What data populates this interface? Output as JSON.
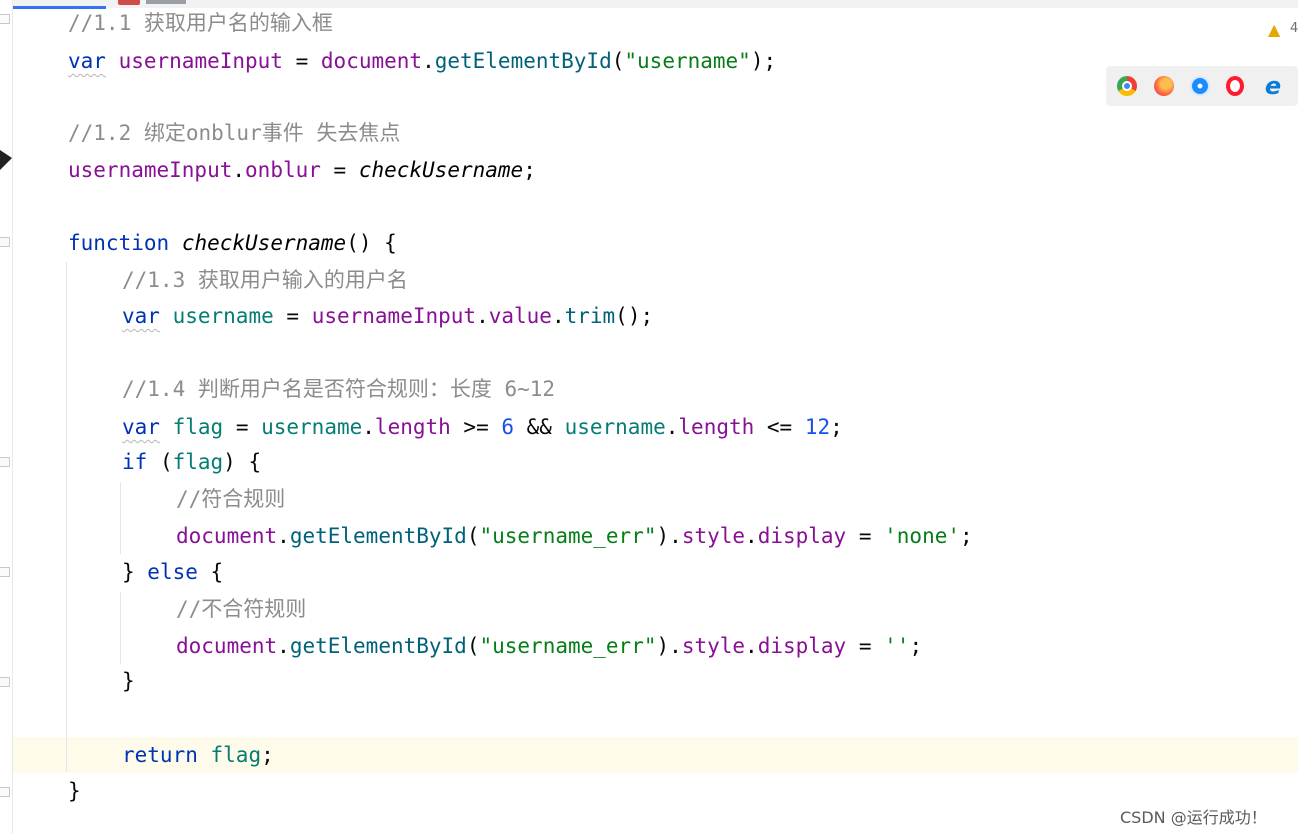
{
  "warnings": {
    "count": "4"
  },
  "browser_icons": [
    "chrome-icon",
    "firefox-icon",
    "safari-icon",
    "opera-icon",
    "edge-icon"
  ],
  "code": {
    "l1": {
      "text": "//1.1 获取用户名的输入框"
    },
    "l2": {
      "kw": "var",
      "name": "usernameInput",
      "eq": " = ",
      "obj": "document",
      "dot": ".",
      "fn": "getElementById",
      "open": "(",
      "str": "\"username\"",
      "close": ");"
    },
    "l3": {
      "text": "//1.2 绑定onblur事件 失去焦点"
    },
    "l4": {
      "obj": "usernameInput",
      "dot": ".",
      "prop": "onblur",
      "eq": " = ",
      "ref": "checkUsername",
      "semi": ";"
    },
    "l5": {
      "kw": "function",
      "name": "checkUsername",
      "tail": "() {"
    },
    "l6": {
      "text": "//1.3 获取用户输入的用户名"
    },
    "l7": {
      "kw": "var",
      "name": "username",
      "eq": " = ",
      "obj": "usernameInput",
      "dot1": ".",
      "prop": "value",
      "dot2": ".",
      "fn": "trim",
      "tail": "();"
    },
    "l8": {
      "text": "//1.4 判断用户名是否符合规则：长度 6~12"
    },
    "l9": {
      "kw": "var",
      "name": "flag",
      "eq": " = ",
      "a": "username",
      "dot1": ".",
      "p1": "length",
      "op1": " >= ",
      "n1": "6",
      "and": " && ",
      "b": "username",
      "dot2": ".",
      "p2": "length",
      "op2": " <= ",
      "n2": "12",
      "semi": ";"
    },
    "l10": {
      "kw": "if",
      "open": " (",
      "v": "flag",
      "close": ") {"
    },
    "l11": {
      "text": "//符合规则"
    },
    "l12": {
      "obj": "document",
      "dot1": ".",
      "fn": "getElementById",
      "open": "(",
      "str": "\"username_err\"",
      "close": ")",
      "dot2": ".",
      "p1": "style",
      "dot3": ".",
      "p2": "display",
      "eq": " = ",
      "val": "'none'",
      "semi": ";"
    },
    "l13": {
      "brace": "} ",
      "kw": "else",
      "tail": " {"
    },
    "l14": {
      "text": "//不合符规则"
    },
    "l15": {
      "obj": "document",
      "dot1": ".",
      "fn": "getElementById",
      "open": "(",
      "str": "\"username_err\"",
      "close": ")",
      "dot2": ".",
      "p1": "style",
      "dot3": ".",
      "p2": "display",
      "eq": " = ",
      "val": "''",
      "semi": ";"
    },
    "l16": {
      "text": "}"
    },
    "l17": {
      "kw": "return",
      "sp": " ",
      "v": "flag",
      "semi": ";"
    },
    "l18": {
      "text": "}"
    }
  },
  "watermark": "CSDN @运行成功！"
}
